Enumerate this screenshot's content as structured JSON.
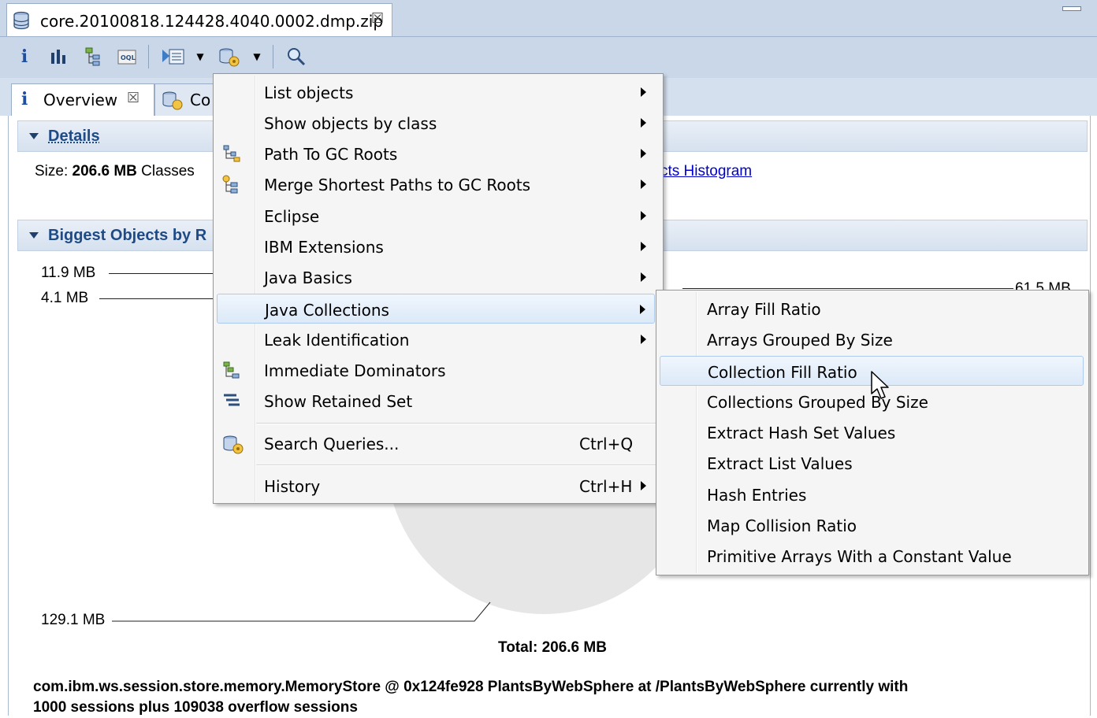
{
  "editor": {
    "tab_title": "core.20100818.124428.4040.0002.dmp.zip",
    "close_glyph": "☒"
  },
  "inner_tabs": {
    "overview_label": "Overview",
    "overview_icon": "i",
    "second_label": "Co",
    "close_glyph": "☒"
  },
  "details": {
    "header": "Details",
    "size_prefix": "Size: ",
    "size_value": "206.6 MB",
    "classes_prefix": " Classes",
    "histogram_link": "cts Histogram"
  },
  "biggest": {
    "header": "Biggest Objects by R",
    "labels": [
      "11.9 MB",
      "4.1 MB",
      "129.1 MB",
      "61.5 MB"
    ],
    "total": "Total: 206.6 MB"
  },
  "footer_text_line1": "com.ibm.ws.session.store.memory.MemoryStore @ 0x124fe928 PlantsByWebSphere at /PlantsByWebSphere currently with",
  "footer_text_line2": "1000 sessions plus 109038 overflow sessions",
  "context_menu": {
    "items": [
      {
        "label": "List objects",
        "icon": "",
        "submenu": true
      },
      {
        "label": "Show objects by class",
        "icon": "",
        "submenu": true
      },
      {
        "label": "Path To GC Roots",
        "icon": "path-tree-icon",
        "submenu": true
      },
      {
        "label": "Merge Shortest Paths to GC Roots",
        "icon": "merge-paths-icon",
        "submenu": true
      },
      {
        "label": "Eclipse",
        "icon": "",
        "submenu": true
      },
      {
        "label": "IBM Extensions",
        "icon": "",
        "submenu": true
      },
      {
        "label": "Java Basics",
        "icon": "",
        "submenu": true
      },
      {
        "label": "Java Collections",
        "icon": "",
        "submenu": true,
        "highlighted": true
      },
      {
        "label": "Leak Identification",
        "icon": "",
        "submenu": true
      },
      {
        "label": "Immediate Dominators",
        "icon": "dominator-tree-icon",
        "submenu": false
      },
      {
        "label": "Show Retained Set",
        "icon": "retained-set-icon",
        "submenu": false
      },
      {
        "label": "Search Queries...",
        "icon": "search-queries-icon",
        "shortcut": "Ctrl+Q",
        "submenu": false
      },
      {
        "label": "History",
        "icon": "",
        "shortcut": "Ctrl+H",
        "submenu": true
      }
    ]
  },
  "collections_submenu": {
    "items": [
      "Array Fill Ratio",
      "Arrays Grouped By Size",
      "Collection Fill Ratio",
      "Collections Grouped By Size",
      "Extract Hash Set Values",
      "Extract List Values",
      "Hash Entries",
      "Map Collision Ratio",
      "Primitive Arrays With a Constant Value"
    ],
    "highlighted_index": 2
  },
  "colors": {
    "chrome": "#c9d7e8",
    "section_header_text": "#1e4a86",
    "link": "#0000cc",
    "pie_gray": "#e6e6e6"
  }
}
